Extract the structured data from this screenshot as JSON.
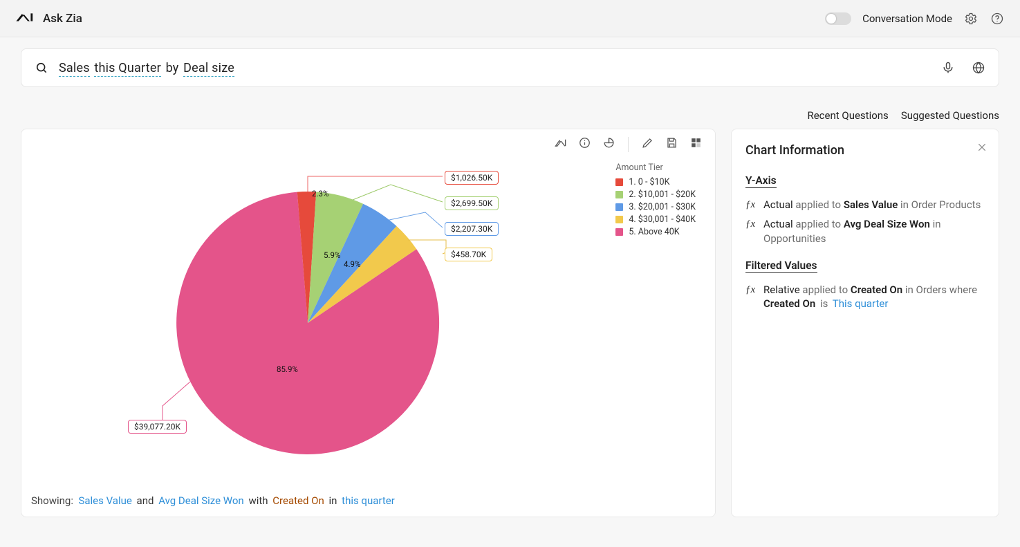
{
  "header": {
    "title": "Ask Zia",
    "mode_label": "Conversation Mode"
  },
  "search": {
    "tokens": [
      "Sales",
      "this Quarter",
      "by",
      "Deal size"
    ],
    "underline_flags": [
      true,
      true,
      false,
      true
    ]
  },
  "links": {
    "recent": "Recent Questions",
    "suggested": "Suggested Questions"
  },
  "legend": {
    "title": "Amount Tier",
    "items": [
      {
        "label": "1. 0 - $10K",
        "color": "#e64a3b"
      },
      {
        "label": "2. $10,001 - $20K",
        "color": "#a6d174"
      },
      {
        "label": "3. $20,001 - $30K",
        "color": "#5f9ae6"
      },
      {
        "label": "4. $30,001 - $40K",
        "color": "#f2c94c"
      },
      {
        "label": "5. Above 40K",
        "color": "#e4548a"
      }
    ]
  },
  "labels": {
    "l0": "$1,026.50K",
    "l1": "$2,699.50K",
    "l2": "$2,207.30K",
    "l3": "$458.70K",
    "l4": "$39,077.20K",
    "p0": "2.3%",
    "p1": "5.9%",
    "p2": "4.9%",
    "p4": "85.9%"
  },
  "showing": {
    "prefix": "Showing:",
    "sales": "Sales Value",
    "and": "and",
    "avg": "Avg Deal Size Won",
    "with": "with",
    "created": "Created On",
    "in": "in",
    "this_q": "this quarter"
  },
  "info": {
    "title": "Chart Information",
    "yaxis_h": "Y-Axis",
    "y1_pre": "Actual",
    "y1_mid": "applied to",
    "y1_b": "Sales Value",
    "y1_post": "in Order Products",
    "y2_pre": "Actual",
    "y2_mid": "applied to",
    "y2_b": "Avg Deal Size Won",
    "y2_post": "in Opportunities",
    "filt_h": "Filtered Values",
    "f1_pre": "Relative",
    "f1_mid": "applied to",
    "f1_b": "Created On",
    "f1_post": "in Orders where",
    "f2_b": "Created On",
    "f2_mid": "is",
    "f2_link": "This quarter"
  },
  "colors": {
    "c0": "#e64a3b",
    "c1": "#a6d174",
    "c2": "#5f9ae6",
    "c3": "#f2c94c",
    "c4": "#e4548a"
  },
  "chart_data": {
    "type": "pie",
    "title": "Sales this Quarter by Deal size",
    "series_name": "Amount Tier",
    "value_unit": "$K",
    "slices": [
      {
        "category": "1. 0 - $10K",
        "value": 1026.5,
        "percent": 2.3,
        "color": "#e64a3b"
      },
      {
        "category": "2. $10,001 - $20K",
        "value": 2699.5,
        "percent": 5.9,
        "color": "#a6d174"
      },
      {
        "category": "3. $20,001 - $30K",
        "value": 2207.3,
        "percent": 4.9,
        "color": "#5f9ae6"
      },
      {
        "category": "4. $30,001 - $40K",
        "value": 458.7,
        "percent": 1.0,
        "color": "#f2c94c"
      },
      {
        "category": "5. Above 40K",
        "value": 39077.2,
        "percent": 85.9,
        "color": "#e4548a"
      }
    ]
  }
}
